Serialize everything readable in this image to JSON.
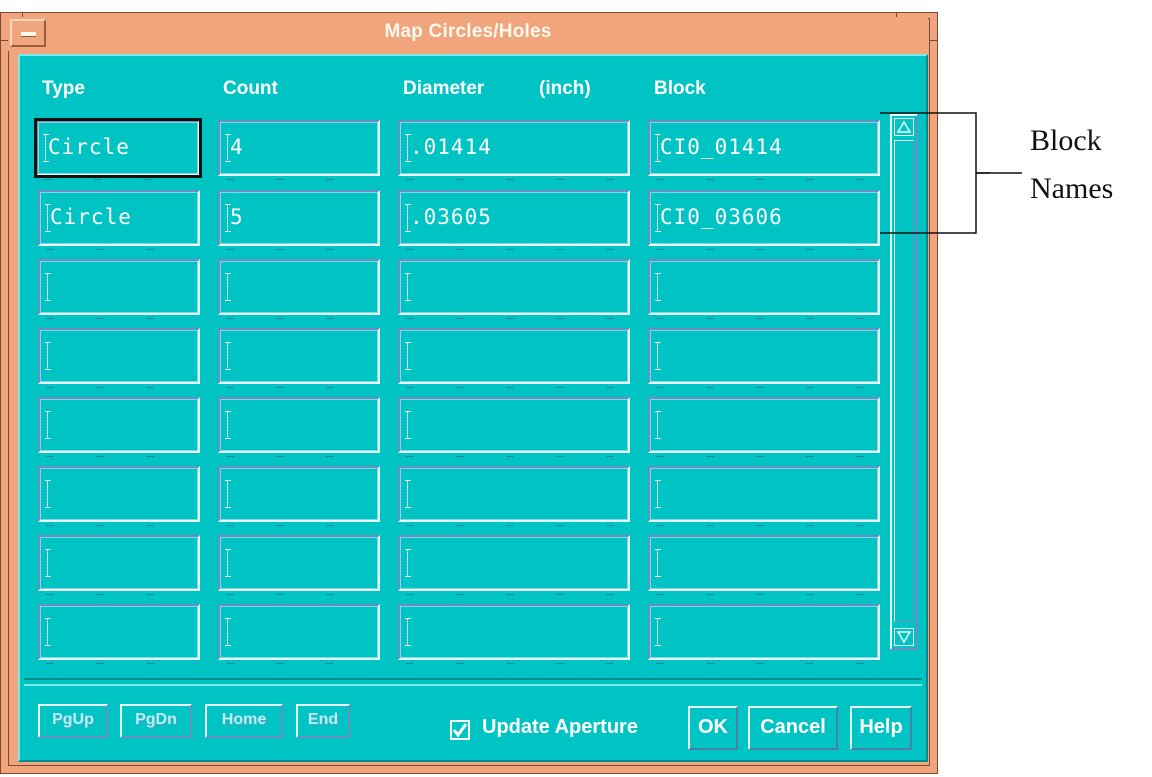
{
  "window": {
    "title": "Map Circles/Holes",
    "menu_icon": "window-menu-dash-icon"
  },
  "table": {
    "headers": {
      "type": "Type",
      "count": "Count",
      "diameter": "Diameter",
      "unit": "(inch)",
      "block": "Block"
    },
    "rows": [
      {
        "type": "Circle",
        "count": "4",
        "diameter": ".01414",
        "block": "CI0_01414"
      },
      {
        "type": "Circle",
        "count": "5",
        "diameter": ".03605",
        "block": "CI0_03606"
      },
      {
        "type": "",
        "count": "",
        "diameter": "",
        "block": ""
      },
      {
        "type": "",
        "count": "",
        "diameter": "",
        "block": ""
      },
      {
        "type": "",
        "count": "",
        "diameter": "",
        "block": ""
      },
      {
        "type": "",
        "count": "",
        "diameter": "",
        "block": ""
      },
      {
        "type": "",
        "count": "",
        "diameter": "",
        "block": ""
      },
      {
        "type": "",
        "count": "",
        "diameter": "",
        "block": ""
      }
    ]
  },
  "nav_buttons": {
    "pgup": "PgUp",
    "pgdn": "PgDn",
    "home": "Home",
    "end": "End"
  },
  "update_aperture": {
    "label": "Update Aperture",
    "checked": true
  },
  "buttons": {
    "ok": "OK",
    "cancel": "Cancel",
    "help": "Help"
  },
  "callout": {
    "line1": "Block",
    "line2": "Names"
  },
  "colors": {
    "frame": "#f0a57c",
    "client": "#00c4c4"
  }
}
